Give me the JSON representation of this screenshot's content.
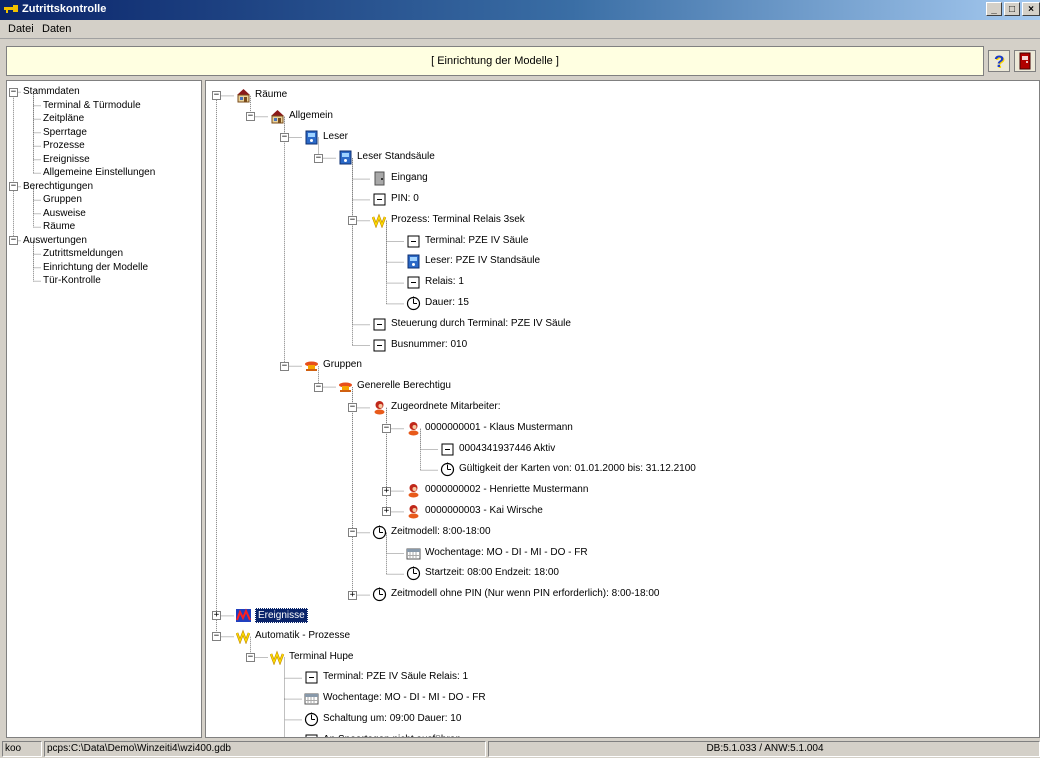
{
  "window": {
    "title": "Zutrittskontrolle",
    "min": "_",
    "max": "□",
    "close": "×"
  },
  "menu": {
    "datei": "Datei",
    "daten": "Daten"
  },
  "header": {
    "title": "[ Einrichtung der Modelle ]",
    "help": "?"
  },
  "left_tree": [
    {
      "label": "Stammdaten",
      "level": 0,
      "exp": "-"
    },
    {
      "label": "Terminal & Türmodule",
      "level": 1
    },
    {
      "label": "Zeitpläne",
      "level": 1
    },
    {
      "label": "Sperrtage",
      "level": 1
    },
    {
      "label": "Prozesse",
      "level": 1
    },
    {
      "label": "Ereignisse",
      "level": 1
    },
    {
      "label": "Allgemeine Einstellungen",
      "level": 1
    },
    {
      "label": "Berechtigungen",
      "level": 0,
      "exp": "-"
    },
    {
      "label": "Gruppen",
      "level": 1
    },
    {
      "label": "Ausweise",
      "level": 1
    },
    {
      "label": "Räume",
      "level": 1
    },
    {
      "label": "Auswertungen",
      "level": 0,
      "exp": "-"
    },
    {
      "label": "Zutrittsmeldungen",
      "level": 1
    },
    {
      "label": "Einrichtung der Modelle",
      "level": 1
    },
    {
      "label": "Tür-Kontrolle",
      "level": 1
    }
  ],
  "model_tree": [
    {
      "label": "Räume",
      "level": 0,
      "exp": "-",
      "icon": "house-icon"
    },
    {
      "label": "Allgemein",
      "level": 1,
      "exp": "-",
      "icon": "house-icon"
    },
    {
      "label": "Leser",
      "level": 2,
      "exp": "-",
      "icon": "reader-icon"
    },
    {
      "label": "Leser Standsäule",
      "level": 3,
      "exp": "-",
      "icon": "reader-icon"
    },
    {
      "label": "Eingang",
      "level": 4,
      "icon": "door-icon"
    },
    {
      "label": "PIN: 0",
      "level": 4,
      "icon": "box-icon"
    },
    {
      "label": "Prozess: Terminal Relais 3sek",
      "level": 4,
      "exp": "-",
      "icon": "process-icon"
    },
    {
      "label": "Terminal: PZE IV Säule",
      "level": 5,
      "icon": "box-icon"
    },
    {
      "label": "Leser: PZE IV  Standsäule",
      "level": 5,
      "icon": "reader-icon"
    },
    {
      "label": "Relais: 1",
      "level": 5,
      "icon": "box-icon"
    },
    {
      "label": "Dauer: 15",
      "level": 5,
      "icon": "clock-icon"
    },
    {
      "label": "Steuerung durch Terminal: PZE IV Säule",
      "level": 4,
      "icon": "box-icon"
    },
    {
      "label": "Busnummer: 010",
      "level": 4,
      "icon": "box-icon"
    },
    {
      "label": "Gruppen",
      "level": 2,
      "exp": "-",
      "icon": "group-icon"
    },
    {
      "label": "Generelle Berechtigu",
      "level": 3,
      "exp": "-",
      "icon": "group-icon"
    },
    {
      "label": "Zugeordnete Mitarbeiter:",
      "level": 4,
      "exp": "-",
      "icon": "person-icon"
    },
    {
      "label": "0000000001 - Klaus Mustermann",
      "level": 5,
      "exp": "-",
      "icon": "person-icon"
    },
    {
      "label": "0004341937446  Aktiv",
      "level": 6,
      "icon": "box-icon"
    },
    {
      "label": "Gültigkeit der Karten von: 01.01.2000 bis: 31.12.2100",
      "level": 6,
      "icon": "clock-icon"
    },
    {
      "label": "0000000002 - Henriette Mustermann",
      "level": 5,
      "exp": "+",
      "icon": "person-icon"
    },
    {
      "label": "0000000003 - Kai Wirsche",
      "level": 5,
      "exp": "+",
      "icon": "person-icon"
    },
    {
      "label": "Zeitmodell: 8:00-18:00",
      "level": 4,
      "exp": "-",
      "icon": "clock-icon"
    },
    {
      "label": "Wochentage: MO - DI - MI - DO - FR",
      "level": 5,
      "icon": "calendar-icon"
    },
    {
      "label": "Startzeit: 08:00 Endzeit: 18:00",
      "level": 5,
      "icon": "clock-icon"
    },
    {
      "label": "Zeitmodell ohne PIN (Nur wenn PIN erforderlich): 8:00-18:00",
      "level": 4,
      "exp": "+",
      "icon": "clock-icon"
    },
    {
      "label": "Ereignisse",
      "level": 0,
      "exp": "+",
      "icon": "event-icon",
      "selected": true
    },
    {
      "label": "Automatik - Prozesse",
      "level": 0,
      "exp": "-",
      "icon": "process-icon"
    },
    {
      "label": "Terminal Hupe",
      "level": 1,
      "exp": "-",
      "icon": "process-icon"
    },
    {
      "label": "Terminal: PZE IV Säule  Relais: 1",
      "level": 2,
      "icon": "box-icon"
    },
    {
      "label": "Wochentage: MO - DI - MI - DO - FR",
      "level": 2,
      "icon": "calendar-icon"
    },
    {
      "label": "Schaltung um: 09:00  Dauer: 10",
      "level": 2,
      "icon": "clock-icon"
    },
    {
      "label": "An Speertagen nicht ausführen",
      "level": 2,
      "icon": "box-icon"
    }
  ],
  "status": {
    "user": "koo",
    "db_path": "pcps:C:\\Data\\Demo\\Winzeiti4\\wzi400.gdb",
    "version": "DB:5.1.033 / ANW:5.1.004"
  }
}
